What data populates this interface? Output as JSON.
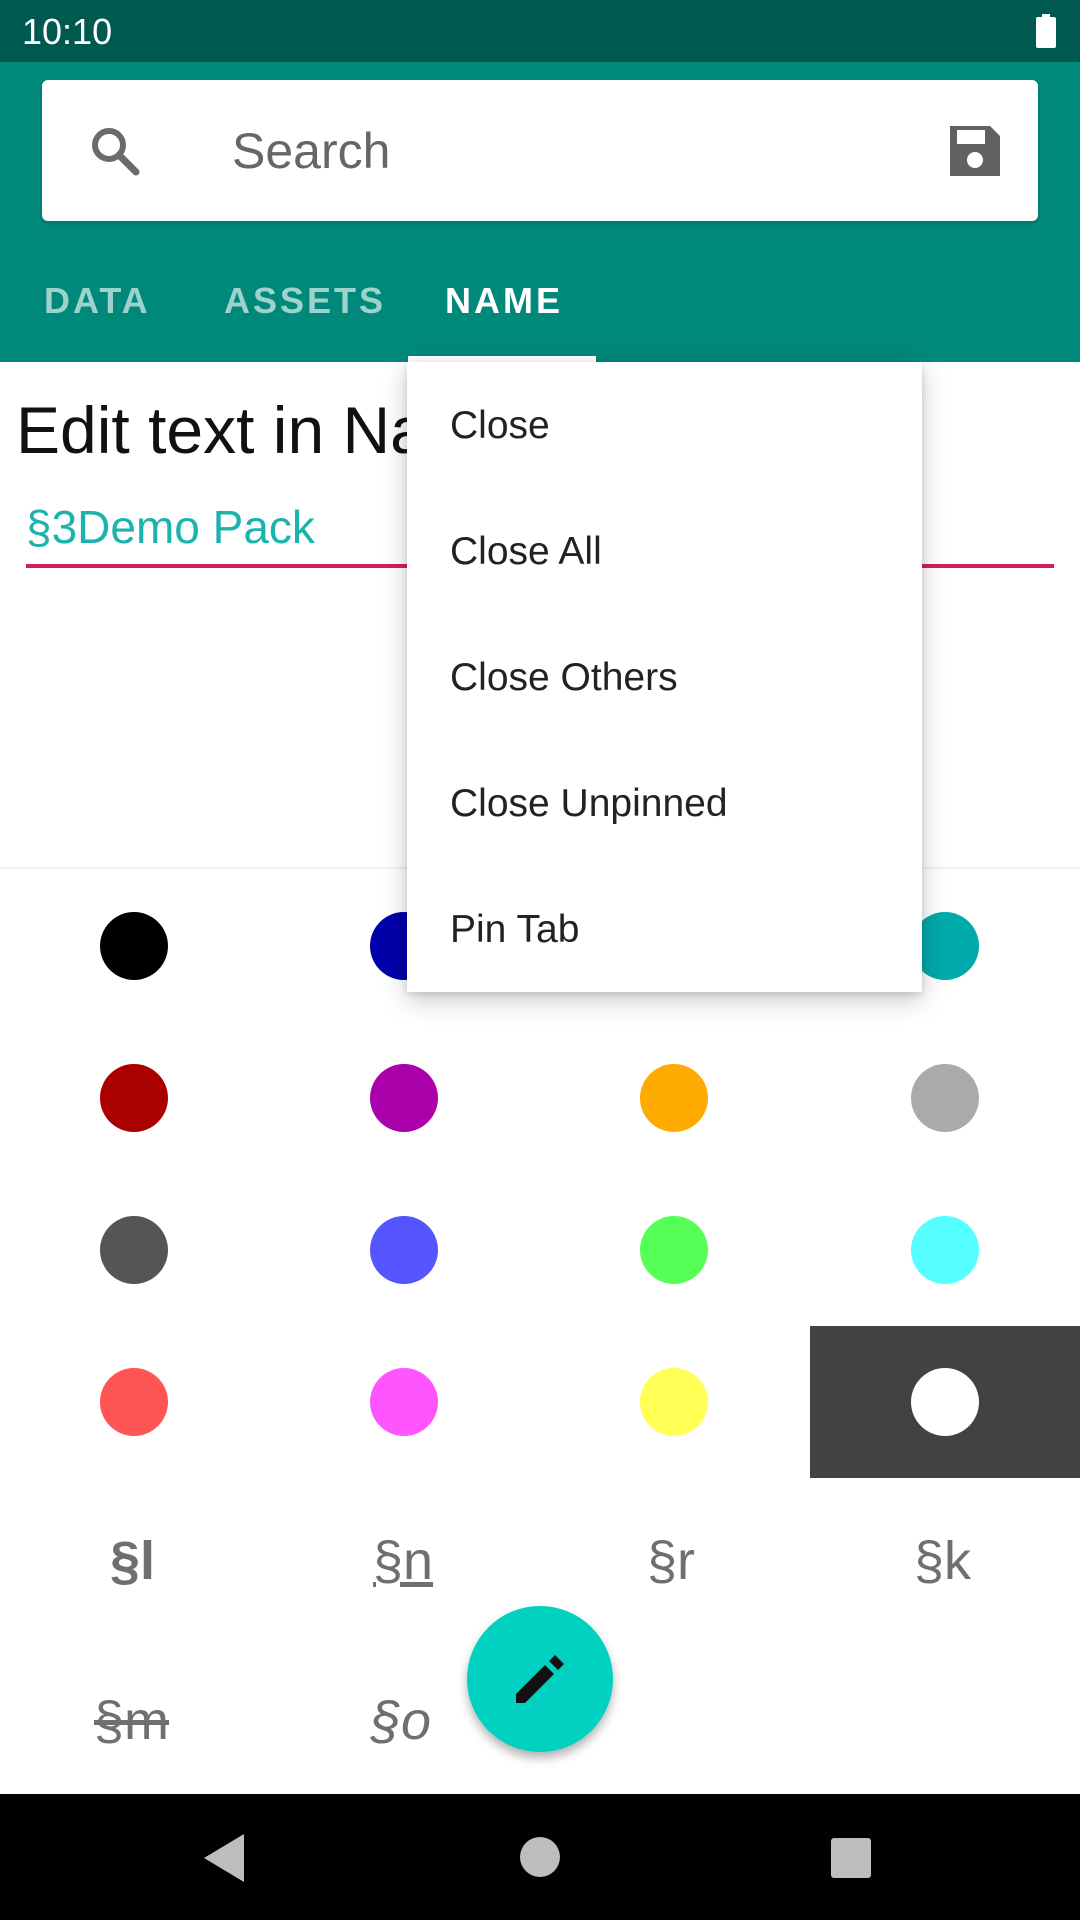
{
  "status_bar": {
    "time": "10:10"
  },
  "search": {
    "placeholder": "Search"
  },
  "tabs": [
    {
      "label": "DATA"
    },
    {
      "label": "ASSETS"
    },
    {
      "label": "NAME",
      "active": true
    }
  ],
  "editor": {
    "title": "Edit text in Na",
    "input_value": "§3Demo Pack"
  },
  "color_swatches": [
    "#000000",
    "#0000aa",
    "#00aaaa",
    "#aa0000",
    "#aa00aa",
    "#ffaa00",
    "#aaaaaa",
    "#555555",
    "#5555ff",
    "#55ff55",
    "#55ffff",
    "#ff5555",
    "#ff55ff",
    "#ffff55",
    "#ffffff"
  ],
  "formatting_codes": [
    "§l",
    "§n",
    "§r",
    "§k",
    "§m",
    "§o"
  ],
  "context_menu": {
    "items": [
      "Close",
      "Close All",
      "Close Others",
      "Close Unpinned",
      "Pin Tab"
    ]
  },
  "fab": {
    "icon": "pencil-icon"
  },
  "colors": {
    "primary": "#00897b",
    "primary_dark": "#00594f",
    "accent": "#00d1c1",
    "underline": "#d81b60"
  }
}
